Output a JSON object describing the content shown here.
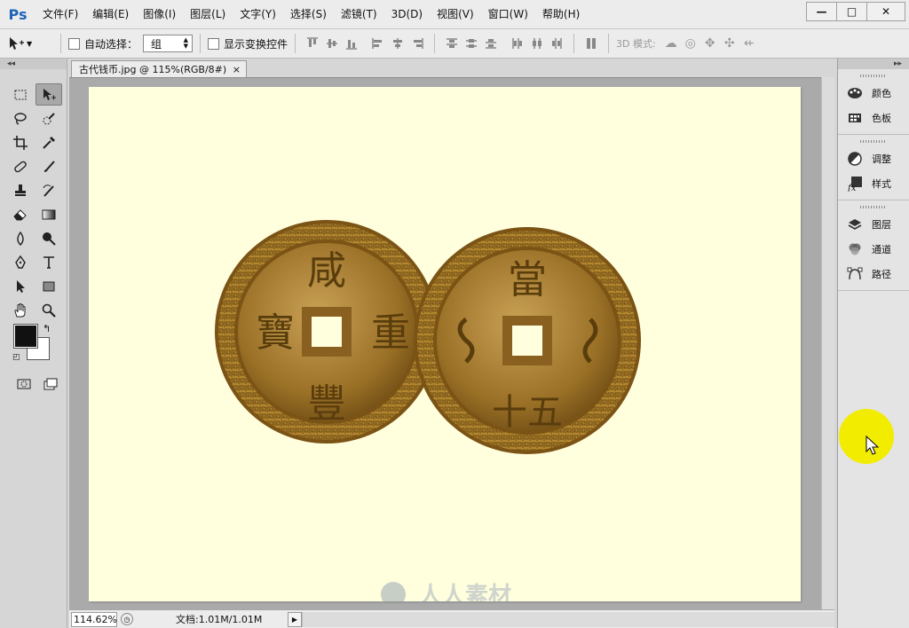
{
  "app": {
    "logo": "Ps"
  },
  "menu": [
    {
      "label": "文件(F)"
    },
    {
      "label": "编辑(E)"
    },
    {
      "label": "图像(I)"
    },
    {
      "label": "图层(L)"
    },
    {
      "label": "文字(Y)"
    },
    {
      "label": "选择(S)"
    },
    {
      "label": "滤镜(T)"
    },
    {
      "label": "3D(D)"
    },
    {
      "label": "视图(V)"
    },
    {
      "label": "窗口(W)"
    },
    {
      "label": "帮助(H)"
    }
  ],
  "window_controls": {
    "minimize": "—",
    "maximize": "□",
    "close": "✕"
  },
  "options": {
    "tool_icon": "move-tool-icon",
    "auto_select_label": "自动选择：",
    "auto_select_checked": false,
    "auto_select_value": "组",
    "show_transform_label": "显示变换控件",
    "show_transform_checked": false,
    "mode_3d_label": "3D 模式:"
  },
  "toolbar": {
    "collapse": "◂◂"
  },
  "document": {
    "tab_title": "古代钱币.jpg @ 115%(RGB/8#)",
    "tab_close": "×",
    "canvas_color": "#fffedd"
  },
  "coins": [
    {
      "top": "咸",
      "bottom": "豐",
      "left": "寶",
      "right": "重"
    },
    {
      "top": "當",
      "bottom": "十五",
      "left": "",
      "right": ""
    }
  ],
  "status": {
    "zoom": "114.62%",
    "doc_size": "文档:1.01M/1.01M",
    "arrow": "▶"
  },
  "panels": {
    "collapse": "▸▸",
    "groups": [
      [
        {
          "label": "颜色",
          "icon": "palette-icon"
        },
        {
          "label": "色板",
          "icon": "swatches-icon"
        }
      ],
      [
        {
          "label": "调整",
          "icon": "adjustments-icon"
        },
        {
          "label": "样式",
          "icon": "styles-icon"
        }
      ],
      [
        {
          "label": "图层",
          "icon": "layers-icon"
        },
        {
          "label": "通道",
          "icon": "channels-icon"
        },
        {
          "label": "路径",
          "icon": "paths-icon"
        }
      ]
    ]
  },
  "watermark": "人人素材",
  "colors": {
    "foreground": "#111111",
    "background": "#ffffff",
    "coin_gold": "#b98a2e",
    "cursor_highlight": "#f2ec00"
  }
}
